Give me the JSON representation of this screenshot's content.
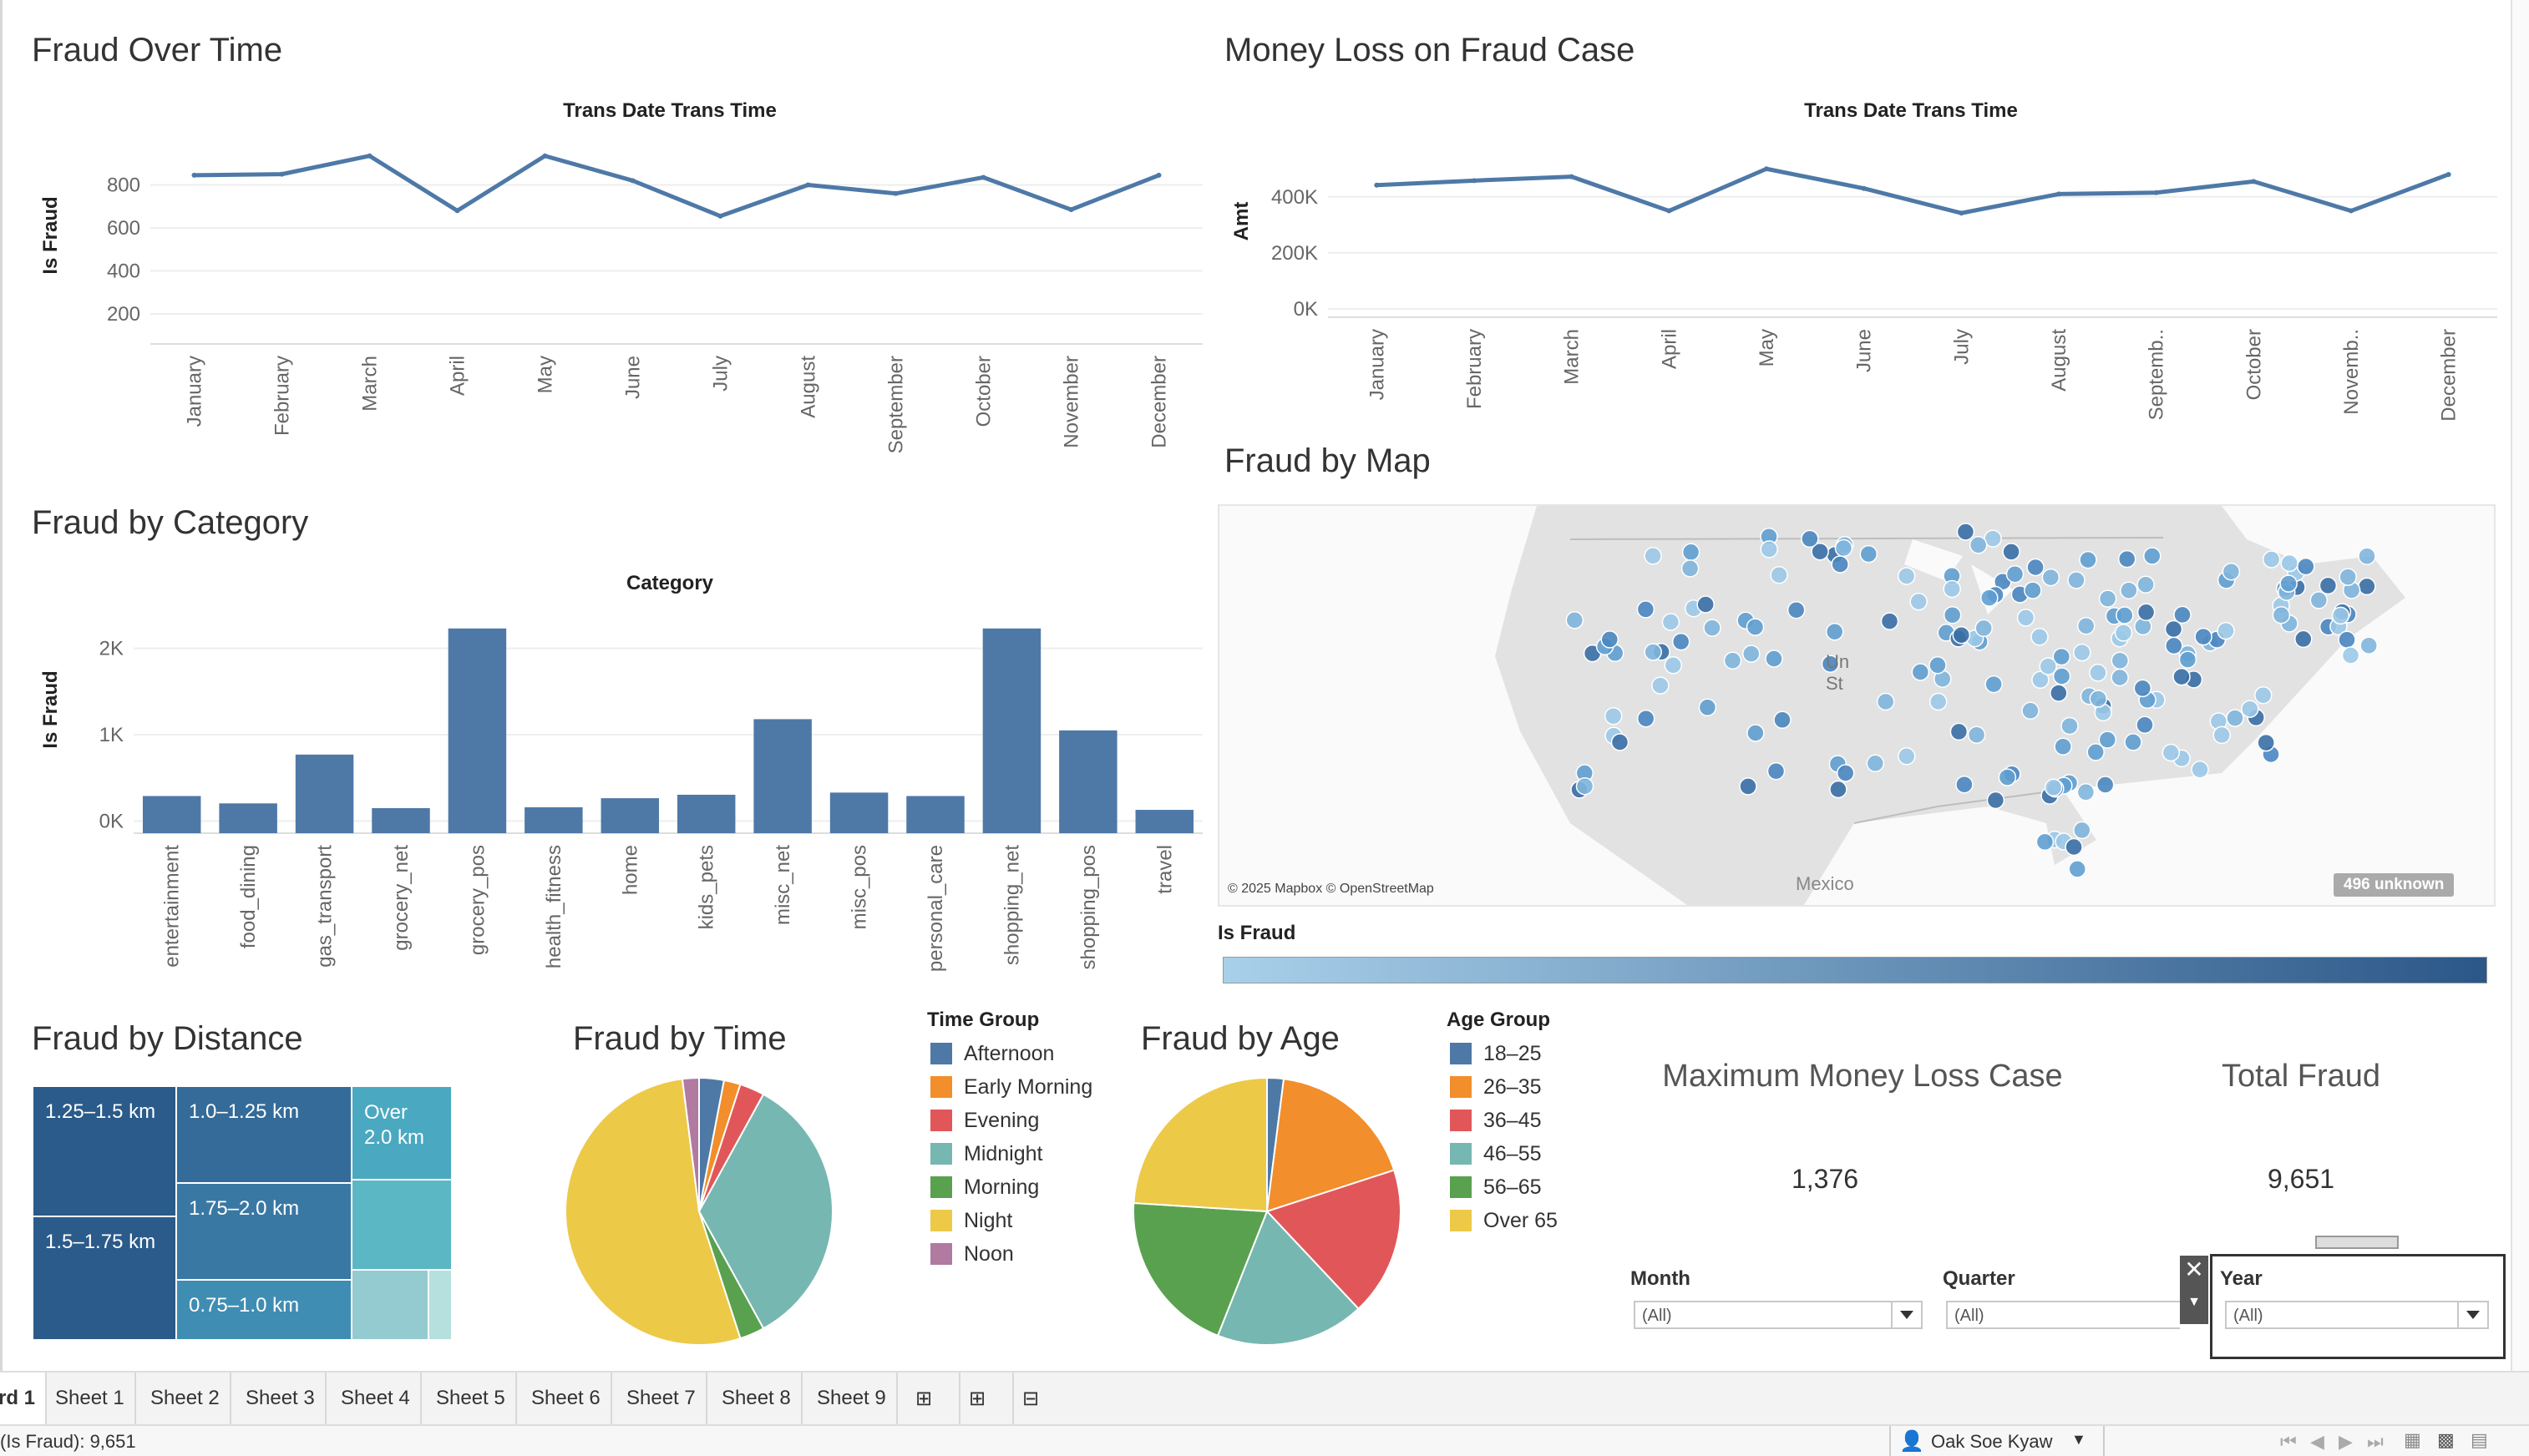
{
  "fraud_over_time": {
    "title": "Fraud Over Time",
    "chart_data": {
      "type": "line",
      "title": "Trans Date Trans Time",
      "ylabel": "Is Fraud",
      "categories": [
        "January",
        "February",
        "March",
        "April",
        "May",
        "June",
        "July",
        "August",
        "September",
        "October",
        "November",
        "December"
      ],
      "values": [
        845,
        850,
        935,
        680,
        935,
        820,
        655,
        800,
        760,
        835,
        685,
        845
      ],
      "yticks": [
        200,
        400,
        600,
        800
      ],
      "ylim": [
        60,
        1000
      ],
      "color": "#4e79a7"
    }
  },
  "money_loss": {
    "title": "Money Loss on Fraud Case",
    "chart_data": {
      "type": "line",
      "title": "Trans Date Trans Time",
      "ylabel": "Amt",
      "categories": [
        "January",
        "February",
        "March",
        "April",
        "May",
        "June",
        "July",
        "August",
        "Septemb..",
        "October",
        "Novemb..",
        "December"
      ],
      "values": [
        442000,
        458000,
        472000,
        350000,
        500000,
        430000,
        342000,
        410000,
        415000,
        455000,
        350000,
        480000
      ],
      "yticks": [
        0,
        200000,
        400000
      ],
      "ytick_labels": [
        "0K",
        "200K",
        "400K"
      ],
      "ylim": [
        -30000,
        620000
      ],
      "color": "#4e79a7"
    }
  },
  "fraud_by_category": {
    "title": "Fraud by Category",
    "chart_data": {
      "type": "bar",
      "title": "Category",
      "ylabel": "Is Fraud",
      "categories": [
        "entertainment",
        "food_dining",
        "gas_transport",
        "grocery_net",
        "grocery_pos",
        "health_fitness",
        "home",
        "kids_pets",
        "misc_net",
        "misc_pos",
        "personal_care",
        "shopping_net",
        "shopping_pos",
        "travel"
      ],
      "values": [
        290,
        205,
        770,
        150,
        2230,
        160,
        265,
        305,
        1180,
        330,
        290,
        2230,
        1050,
        130
      ],
      "yticks": [
        0,
        1000,
        2000
      ],
      "ytick_labels": [
        "0K",
        "1K",
        "2K"
      ],
      "ylim": [
        -140,
        2450
      ],
      "color": "#4e79a7"
    }
  },
  "fraud_by_map": {
    "title": "Fraud by Map",
    "attribution": "© 2025 Mapbox © OpenStreetMap",
    "country_label": "Mexico",
    "us_label_1": "Un",
    "us_label_2": "St",
    "unknown_badge": "496 unknown",
    "legend_title": "Is Fraud",
    "ramp_start": "#a9d0ea",
    "ramp_end": "#2b5788"
  },
  "fraud_by_distance": {
    "title": "Fraud by Distance",
    "cells": [
      {
        "label": "1.25–1.5 km",
        "color": "#2b5b8a"
      },
      {
        "label": "1.5–1.75 km",
        "color": "#2b5b8a"
      },
      {
        "label": "1.0–1.25 km",
        "color": "#346b99"
      },
      {
        "label": "1.75–2.0 km",
        "color": "#3a78a4"
      },
      {
        "label": "0.75–1.0 km",
        "color": "#3f8db3"
      },
      {
        "label": "Over\n2.0 km",
        "color": "#4aa9c0"
      },
      {
        "label": "",
        "color": "#5cb7c4"
      },
      {
        "label": "",
        "color": "#94cbd1"
      },
      {
        "label": "",
        "color": "#b6e0dd"
      }
    ]
  },
  "fraud_by_time": {
    "title": "Fraud by Time",
    "legend_title": "Time Group",
    "chart_data": {
      "type": "pie",
      "labels": [
        "Afternoon",
        "Early Morning",
        "Evening",
        "Midnight",
        "Morning",
        "Night",
        "Noon"
      ],
      "values": [
        3,
        2,
        3,
        34,
        3,
        53,
        2
      ],
      "colors": [
        "#4e79a7",
        "#f28e2b",
        "#e15759",
        "#76b7b2",
        "#59a14f",
        "#edc948",
        "#b07aa1"
      ]
    }
  },
  "fraud_by_age": {
    "title": "Fraud by Age",
    "legend_title": "Age Group",
    "chart_data": {
      "type": "pie",
      "labels": [
        "18–25",
        "26–35",
        "36–45",
        "46–55",
        "56–65",
        "Over 65"
      ],
      "values": [
        2,
        18,
        18,
        18,
        20,
        24
      ],
      "colors": [
        "#4e79a7",
        "#f28e2b",
        "#e15759",
        "#76b7b2",
        "#59a14f",
        "#edc948"
      ]
    }
  },
  "kpis": {
    "max_loss_title": "Maximum Money Loss Case",
    "max_loss_value": "1,376",
    "total_fraud_title": "Total Fraud",
    "total_fraud_value": "9,651"
  },
  "filters": {
    "month_label": "Month",
    "month_value": "(All)",
    "quarter_label": "Quarter",
    "quarter_value": "(All)",
    "year_label": "Year",
    "year_value": "(All)"
  },
  "tabs": {
    "active": "rd 1",
    "items": [
      "Sheet 1",
      "Sheet 2",
      "Sheet 3",
      "Sheet 4",
      "Sheet 5",
      "Sheet 6",
      "Sheet 7",
      "Sheet 8",
      "Sheet 9"
    ]
  },
  "status": {
    "summary": "(Is Fraud): 9,651",
    "user": "Oak Soe Kyaw"
  }
}
